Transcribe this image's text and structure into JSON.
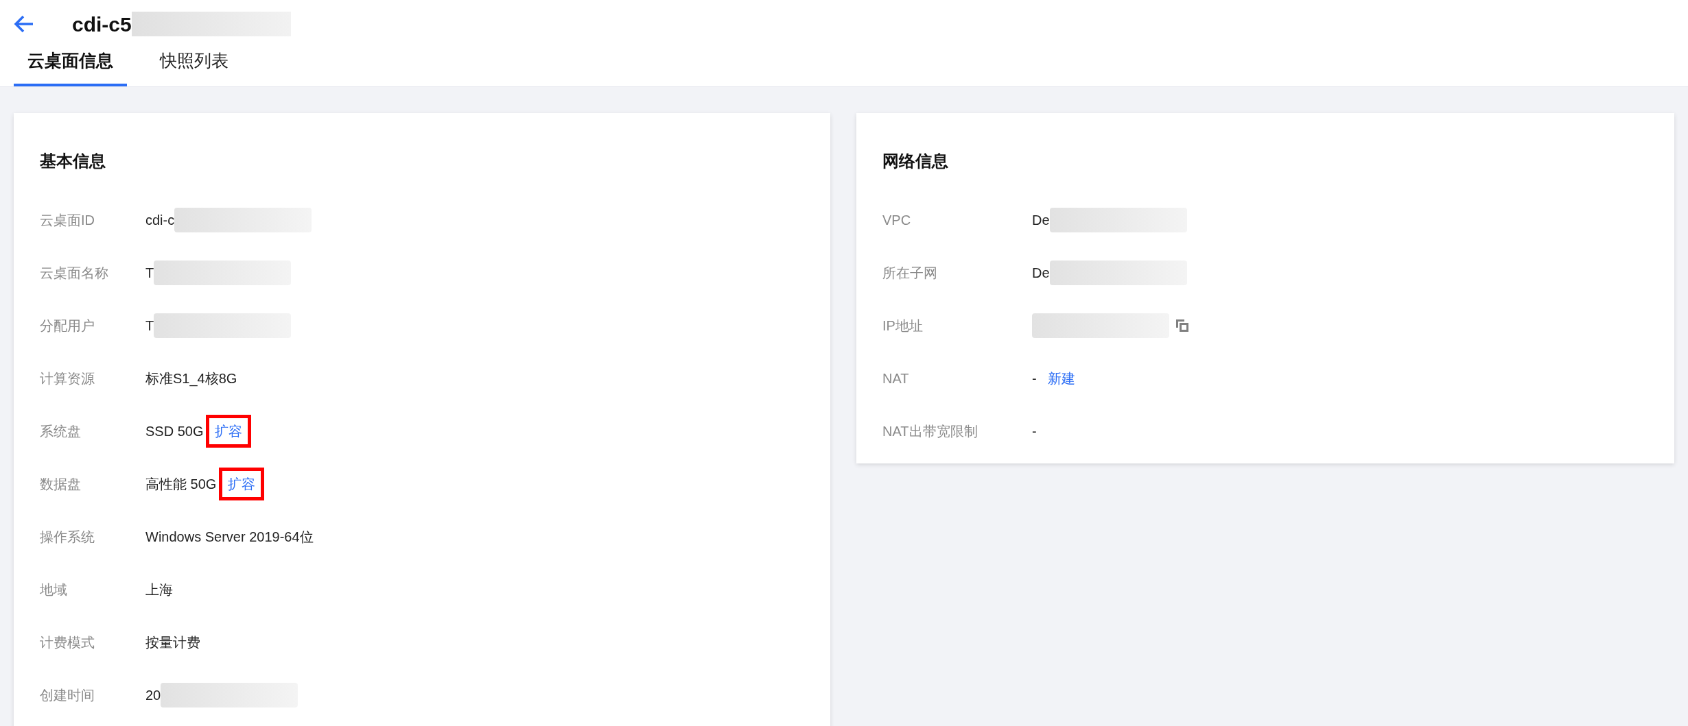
{
  "header": {
    "title": "cdi-c5",
    "title_redacted": true
  },
  "tabs": [
    {
      "label": "云桌面信息",
      "selected": true
    },
    {
      "label": "快照列表",
      "selected": false
    }
  ],
  "basic_info": {
    "title": "基本信息",
    "rows": [
      {
        "label": "云桌面ID",
        "value": "cdi-c",
        "redacted": true
      },
      {
        "label": "云桌面名称",
        "value": "T",
        "redacted": true
      },
      {
        "label": "分配用户",
        "value": "T",
        "redacted": true
      },
      {
        "label": "计算资源",
        "value": "标准S1_4核8G"
      },
      {
        "label": "系统盘",
        "value": "SSD 50G",
        "link": {
          "text": "扩容",
          "highlighted": true
        }
      },
      {
        "label": "数据盘",
        "value": "高性能 50G",
        "link": {
          "text": "扩容",
          "highlighted": true
        }
      },
      {
        "label": "操作系统",
        "value": "Windows Server 2019-64位"
      },
      {
        "label": "地域",
        "value": "上海"
      },
      {
        "label": "计费模式",
        "value": "按量计费"
      },
      {
        "label": "创建时间",
        "value": "20",
        "redacted": true
      }
    ]
  },
  "network_info": {
    "title": "网络信息",
    "rows": [
      {
        "label": "VPC",
        "value": "De",
        "redacted": true
      },
      {
        "label": "所在子网",
        "value": "De",
        "redacted": true
      },
      {
        "label": "IP地址",
        "redacted": true,
        "copyable": true
      },
      {
        "label": "NAT",
        "value": "-",
        "link": {
          "text": "新建",
          "highlighted": false
        }
      },
      {
        "label": "NAT出带宽限制",
        "value": "-"
      }
    ]
  }
}
